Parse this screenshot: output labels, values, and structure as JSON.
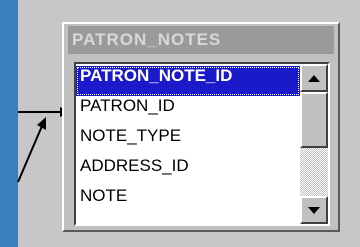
{
  "table": {
    "title": "PATRON_NOTES",
    "columns": [
      {
        "label": "PATRON_NOTE_ID",
        "selected": true
      },
      {
        "label": "PATRON_ID",
        "selected": false
      },
      {
        "label": "NOTE_TYPE",
        "selected": false
      },
      {
        "label": "ADDRESS_ID",
        "selected": false
      },
      {
        "label": "NOTE",
        "selected": false
      }
    ]
  },
  "scrollbar": {
    "up_icon": "triangle-up-icon",
    "down_icon": "triangle-down-icon"
  },
  "colors": {
    "background": "#3a7fbc",
    "selection": "#1a1acb",
    "title_bar": "#9a9a9a"
  }
}
